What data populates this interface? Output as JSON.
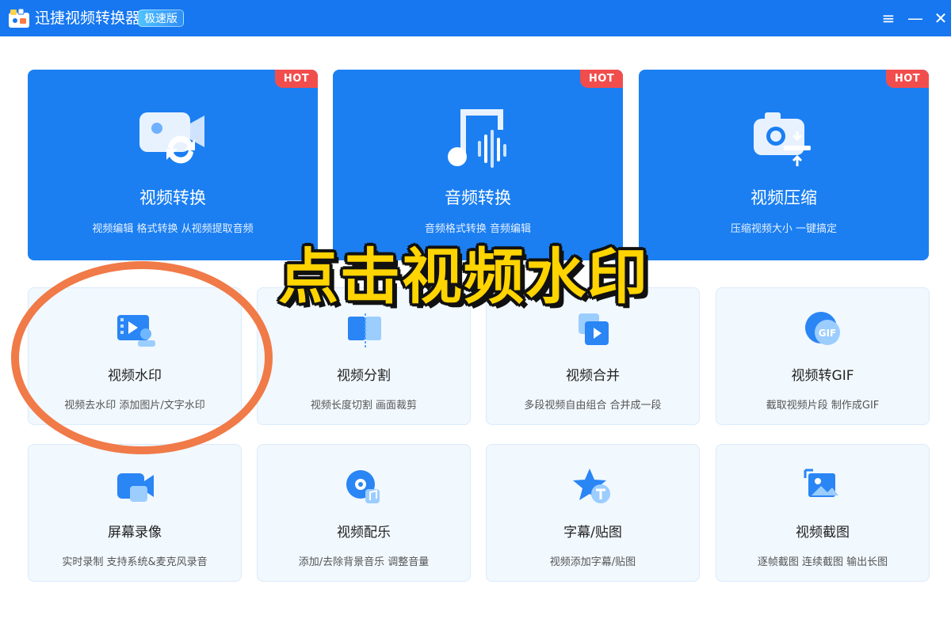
{
  "titlebar": {
    "app_title": "迅捷视频转换器",
    "badge": "极速版",
    "menu_icon": "≡",
    "minimize_icon": "—",
    "close_icon": "✕"
  },
  "big_cards": [
    {
      "title": "视频转换",
      "subtitle": "视频编辑 格式转换 从视频提取音频",
      "hot": "HOT",
      "icon": "video-convert-icon"
    },
    {
      "title": "音频转换",
      "subtitle": "音频格式转换 音频编辑",
      "hot": "HOT",
      "icon": "audio-convert-icon"
    },
    {
      "title": "视频压缩",
      "subtitle": "压缩视频大小 一键搞定",
      "hot": "HOT",
      "icon": "video-compress-icon"
    }
  ],
  "small_cards": [
    {
      "title": "视频水印",
      "subtitle": "视频去水印 添加图片/文字水印",
      "icon": "video-watermark-icon"
    },
    {
      "title": "视频分割",
      "subtitle": "视频长度切割 画面裁剪",
      "icon": "video-split-icon"
    },
    {
      "title": "视频合并",
      "subtitle": "多段视频自由组合 合并成一段",
      "icon": "video-merge-icon"
    },
    {
      "title": "视频转GIF",
      "subtitle": "截取视频片段 制作成GIF",
      "icon": "gif-icon"
    },
    {
      "title": "屏幕录像",
      "subtitle": "实时录制 支持系统&麦克风录音",
      "icon": "screen-record-icon"
    },
    {
      "title": "视频配乐",
      "subtitle": "添加/去除背景音乐 调整音量",
      "icon": "music-icon"
    },
    {
      "title": "字幕/贴图",
      "subtitle": "视频添加字幕/贴图",
      "icon": "subtitle-sticker-icon"
    },
    {
      "title": "视频截图",
      "subtitle": "逐帧截图 连续截图 输出长图",
      "icon": "screenshot-icon"
    }
  ],
  "overlay": {
    "caption": "点击视频水印"
  },
  "gif_icon_label": "GIF",
  "colors": {
    "titlebar": "#1677f0",
    "card_blue": "#1b7ff2",
    "hot": "#f24d4d",
    "highlight_circle": "#f07a48",
    "caption": "#ffd400"
  }
}
